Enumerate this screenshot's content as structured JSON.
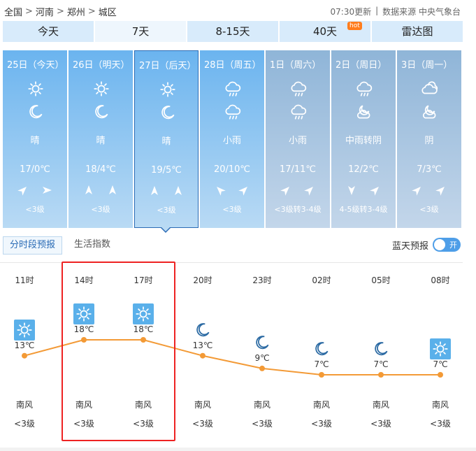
{
  "breadcrumb": {
    "items": [
      "全国",
      "河南",
      "郑州",
      "城区"
    ],
    "sep": ">"
  },
  "update": {
    "time_text": "07:30更新",
    "divider": "|",
    "source": "数据来源 中央气象台"
  },
  "tabs": [
    {
      "label": "今天"
    },
    {
      "label": "7天"
    },
    {
      "label": "8-15天"
    },
    {
      "label": "40天",
      "badge": "hot"
    },
    {
      "label": "雷达图"
    }
  ],
  "active_tab": "7天",
  "days": [
    {
      "date": "25日（今天）",
      "icons": [
        "sun-icon",
        "moon-icon"
      ],
      "weather": "晴",
      "temp": "17/0℃",
      "winds": [
        "arrow-northeast",
        "arrow-east"
      ],
      "wind_level": "<3级",
      "bg": "#6bb4ef"
    },
    {
      "date": "26日（明天）",
      "icons": [
        "sun-icon",
        "moon-icon"
      ],
      "weather": "晴",
      "temp": "18/4℃",
      "winds": [
        "arrow-north",
        "arrow-north"
      ],
      "wind_level": "<3级",
      "bg": "#6bb4ef"
    },
    {
      "date": "27日（后天）",
      "icons": [
        "sun-icon",
        "moon-icon"
      ],
      "weather": "晴",
      "temp": "19/5℃",
      "winds": [
        "arrow-north",
        "arrow-north"
      ],
      "wind_level": "<3级",
      "bg": "#6bb4ef"
    },
    {
      "date": "28日（周五）",
      "icons": [
        "rain-cloud-icon",
        "rain-cloud-icon"
      ],
      "weather": "小雨",
      "temp": "20/10℃",
      "winds": [
        "arrow-northwest",
        "arrow-northeast"
      ],
      "wind_level": "<3级",
      "bg": "#6bb4ef"
    },
    {
      "date": "1日（周六）",
      "icons": [
        "rain-cloud-icon",
        "rain-cloud-icon"
      ],
      "weather": "小雨",
      "temp": "17/11℃",
      "winds": [
        "arrow-northeast",
        "arrow-northeast"
      ],
      "wind_level": "<3级转3-4级",
      "bg": "#8fb5d8"
    },
    {
      "date": "2日（周日）",
      "icons": [
        "rain-cloud-icon",
        "partly-cloudy-night-icon"
      ],
      "weather": "中雨转阴",
      "temp": "12/2℃",
      "winds": [
        "arrow-south",
        "arrow-northeast"
      ],
      "wind_level": "4-5级转3-4级",
      "bg": "#8fb5d8"
    },
    {
      "date": "3日（周一）",
      "icons": [
        "cloud-icon",
        "partly-cloudy-night-icon"
      ],
      "weather": "阴",
      "temp": "7/3℃",
      "winds": [
        "arrow-northeast",
        "arrow-northeast"
      ],
      "wind_level": "<3级",
      "bg": "#8fb5d8"
    }
  ],
  "selected_day": "27日（后天）",
  "subtabs": [
    {
      "label": "分时段预报"
    },
    {
      "label": "生活指数"
    }
  ],
  "active_subtab": "分时段预报",
  "radar_toggle": {
    "label": "蓝天预报",
    "state": "开"
  },
  "hourly": [
    {
      "time": "11时",
      "icon": "sun-icon",
      "temp_label": "13℃",
      "temp": 13,
      "wind_dir": "南风",
      "wind_level": "<3级"
    },
    {
      "time": "14时",
      "icon": "sun-icon",
      "temp_label": "18℃",
      "temp": 18,
      "wind_dir": "南风",
      "wind_level": "<3级"
    },
    {
      "time": "17时",
      "icon": "sun-icon",
      "temp_label": "18℃",
      "temp": 18,
      "wind_dir": "南风",
      "wind_level": "<3级"
    },
    {
      "time": "20时",
      "icon": "moon-icon",
      "temp_label": "13℃",
      "temp": 13,
      "wind_dir": "南风",
      "wind_level": "<3级"
    },
    {
      "time": "23时",
      "icon": "moon-icon",
      "temp_label": "9℃",
      "temp": 9,
      "wind_dir": "南风",
      "wind_level": "<3级"
    },
    {
      "time": "02时",
      "icon": "moon-icon",
      "temp_label": "7℃",
      "temp": 7,
      "wind_dir": "南风",
      "wind_level": "<3级"
    },
    {
      "time": "05时",
      "icon": "moon-icon",
      "temp_label": "7℃",
      "temp": 7,
      "wind_dir": "南风",
      "wind_level": "<3级"
    },
    {
      "time": "08时",
      "icon": "sun-icon",
      "temp_label": "7℃",
      "temp": 7,
      "wind_dir": "南风",
      "wind_level": "<3级"
    }
  ],
  "colors": {
    "line": "#f39a36",
    "sun_tile": "#5ab0ea",
    "red_highlight": "#e22222",
    "hot_badge": "#ff7d1d"
  }
}
